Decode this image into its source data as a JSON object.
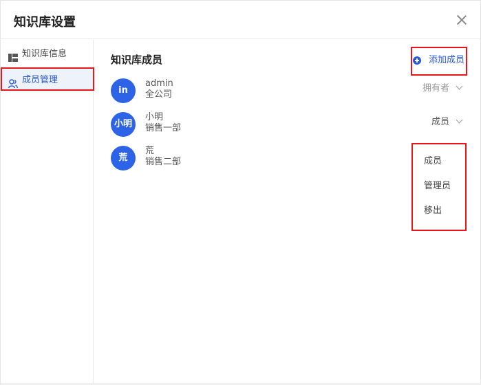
{
  "dialog": {
    "title": "知识库设置"
  },
  "sidebar": {
    "items": [
      {
        "label": "知识库信息",
        "icon": "layout-icon",
        "active": false
      },
      {
        "label": "成员管理",
        "icon": "users-icon",
        "active": true
      }
    ]
  },
  "main": {
    "title": "知识库成员",
    "add_member_label": "添加成员",
    "members": [
      {
        "avatar_text": "in",
        "name": "admin",
        "dept": "全公司",
        "role": "拥有者"
      },
      {
        "avatar_text": "小明",
        "name": "小明",
        "dept": "销售一部",
        "role": "成员"
      },
      {
        "avatar_text": "荒",
        "name": "荒",
        "dept": "销售二部",
        "role": ""
      }
    ],
    "role_dropdown": {
      "options": [
        "成员",
        "管理员",
        "移出"
      ]
    }
  },
  "colors": {
    "accent": "#2a5bd7",
    "avatar_bg": "#2d63e6",
    "highlight_border": "#e8151b"
  }
}
